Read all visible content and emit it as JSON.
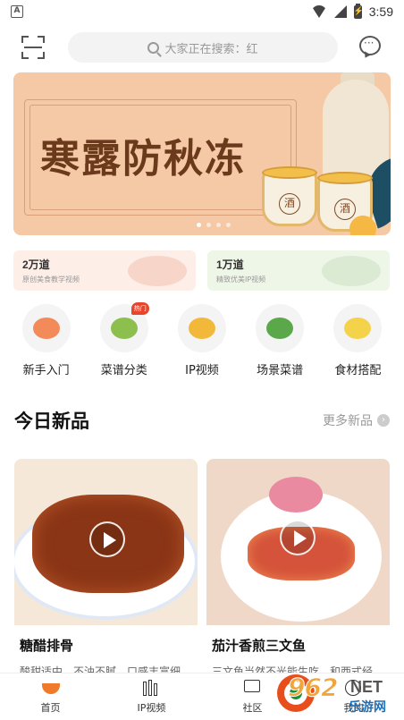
{
  "status_bar": {
    "time": "3:59"
  },
  "header": {
    "search_placeholder": "大家正在搜索：红"
  },
  "banner": {
    "title": "寒露防秋冻",
    "cup_mark": "酒",
    "slide_count": 4,
    "active_slide": 1
  },
  "promos": [
    {
      "count": "2万道",
      "caption": "原创美食教学视频"
    },
    {
      "count": "1万道",
      "caption": "精致优美IP视频"
    }
  ],
  "categories": [
    {
      "label": "新手入门",
      "icon": "salmon-dish-icon"
    },
    {
      "label": "菜谱分类",
      "icon": "veggie-plate-icon",
      "badge": "热门"
    },
    {
      "label": "IP视频",
      "icon": "fries-icon"
    },
    {
      "label": "场景菜谱",
      "icon": "salad-icon"
    },
    {
      "label": "食材搭配",
      "icon": "egg-bacon-icon"
    }
  ],
  "section": {
    "title": "今日新品",
    "more": "更多新品"
  },
  "cards": [
    {
      "name": "糖醋排骨",
      "desc": "酸甜适中，不油不腻，口感丰富细"
    },
    {
      "name": "茄汁香煎三文鱼",
      "desc": "三文鱼当然不光能生吃，和西式经"
    }
  ],
  "tabbar": [
    {
      "label": "首页",
      "active": true
    },
    {
      "label": "IP视频",
      "active": false
    },
    {
      "label": "社区",
      "active": false
    },
    {
      "label": "我的",
      "active": false
    }
  ],
  "watermark": {
    "number": "962",
    "domain": "NET",
    "site": "乐游网"
  },
  "colors": {
    "accent": "#f07a2a",
    "badge": "#e8452c",
    "banner_bg": "#f6c9a6",
    "banner_title": "#6b3a1d"
  }
}
